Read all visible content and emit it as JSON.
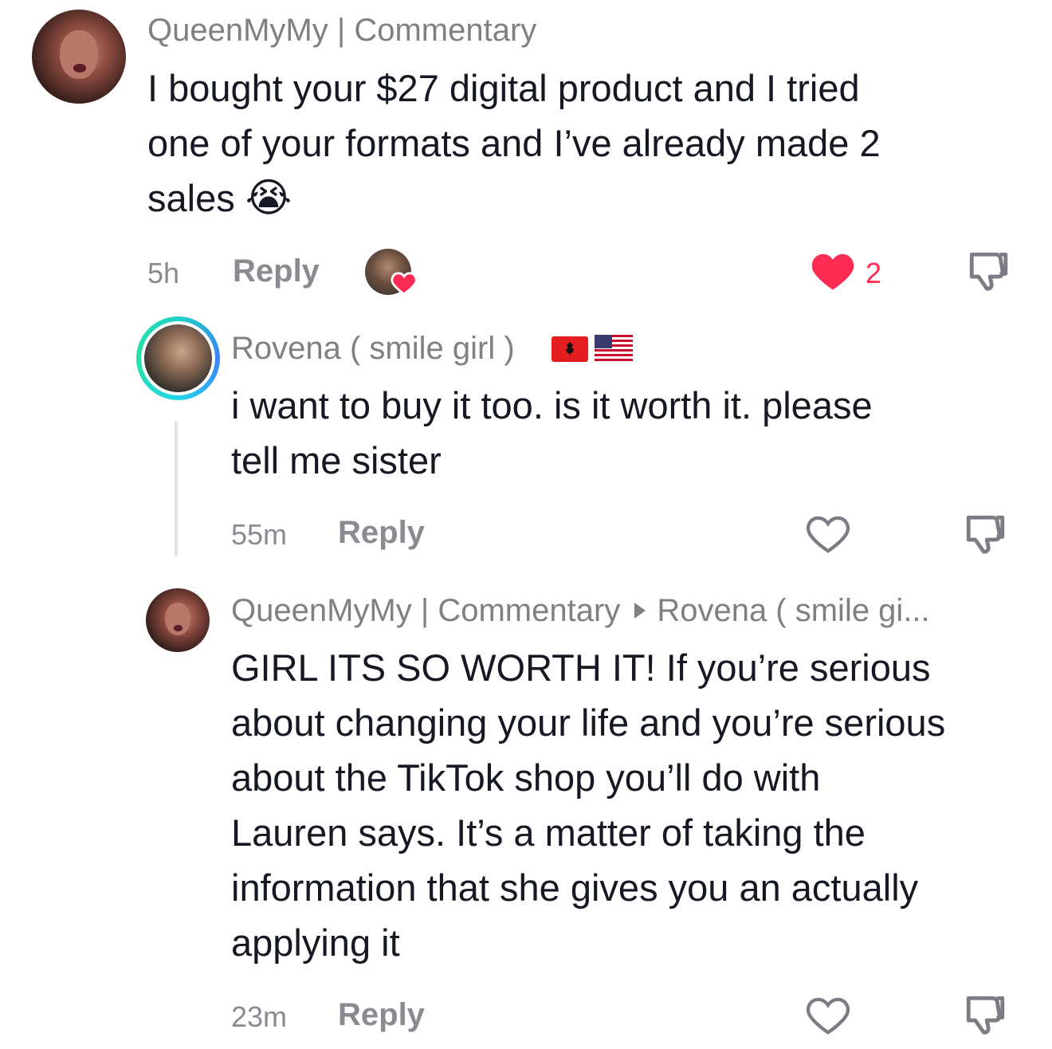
{
  "comments": [
    {
      "username": "QueenMyMy | Commentary",
      "text_lines": [
        "I bought your $27 digital product and I tried",
        "one of your formats and I’ve already made 2",
        "sales"
      ],
      "emoji": "😭",
      "time": "5h",
      "reply_label": "Reply",
      "likes": "2",
      "liked": true,
      "creator_liked": true
    }
  ],
  "replies": [
    {
      "username": "Rovena ( smile girl )",
      "flags": [
        "albania-flag",
        "usa-flag"
      ],
      "text_lines": [
        "i want to buy it too. is it worth it. please",
        "tell me sister"
      ],
      "time": "55m",
      "reply_label": "Reply"
    },
    {
      "username": "QueenMyMy | Commentary",
      "reply_to": "Rovena ( smile gi...",
      "text_lines": [
        "GIRL ITS SO WORTH IT! If you’re serious",
        "about changing your life and you’re serious",
        "about the TikTok shop you’ll do with",
        "Lauren says. It’s a matter of taking the",
        "information that she gives you an actually",
        "applying it"
      ],
      "time": "23m",
      "reply_label": "Reply"
    }
  ],
  "colors": {
    "like": "#fe2c55",
    "muted": "#8a8b91",
    "text": "#161823"
  }
}
